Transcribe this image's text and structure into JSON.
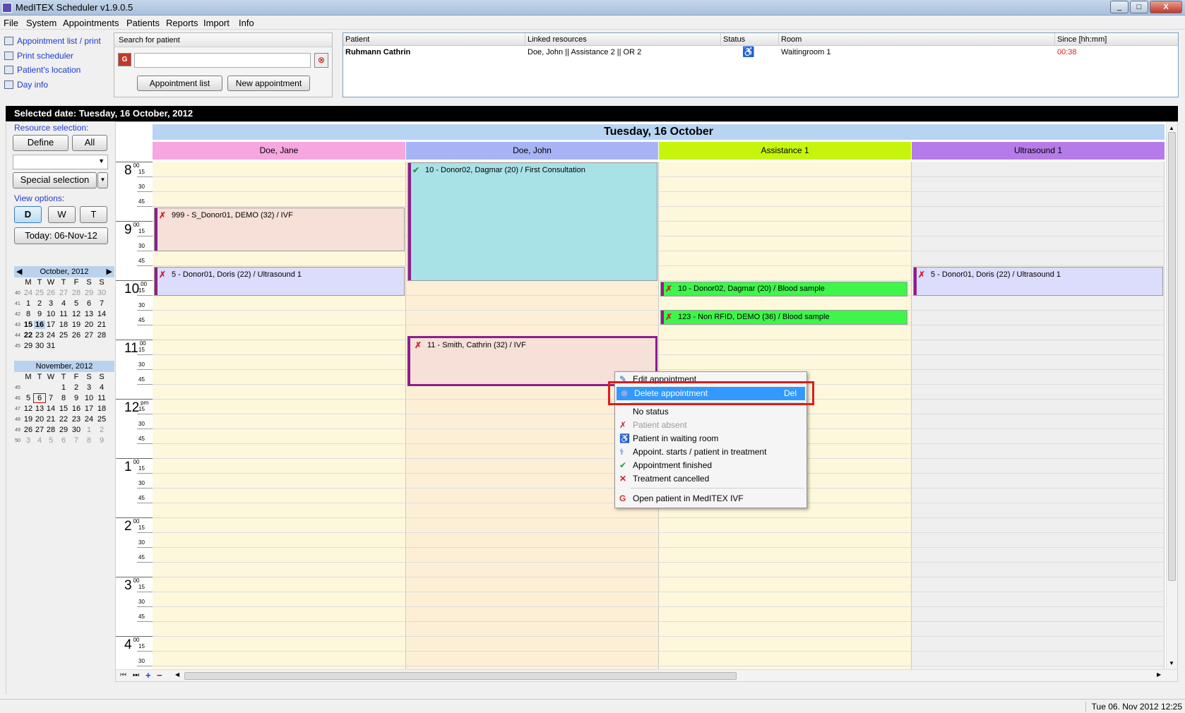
{
  "window": {
    "title": "MedITEX  Scheduler v1.9.0.5",
    "min": "_",
    "max": "□",
    "close": "X"
  },
  "menu": [
    "File",
    "System",
    "Appointments",
    "Patients",
    "Reports",
    "Import",
    "Info"
  ],
  "left_links": [
    "Appointment list / print",
    "Print scheduler",
    "Patient's location",
    "Day info"
  ],
  "search": {
    "header": "Search for patient",
    "input_value": "",
    "appointment_list": "Appointment list",
    "new_appointment": "New appointment"
  },
  "waiting": {
    "columns": [
      "Patient",
      "Linked resources",
      "Status",
      "Room",
      "Since [hh:mm]"
    ],
    "row": {
      "patient": "Ruhmann Cathrin",
      "resources": "Doe, John || Assistance 2 || OR 2",
      "room": "Waitingroom 1",
      "since": "00:38"
    }
  },
  "selected_date": "Selected date: Tuesday, 16 October, 2012",
  "options": {
    "resource_selection": "Resource selection:",
    "define": "Define",
    "all": "All",
    "special_selection": "Special selection",
    "view_options": "View options:",
    "view_buttons": [
      "D",
      "W",
      "T"
    ],
    "today": "Today: 06-Nov-12"
  },
  "calendar": {
    "oct": {
      "title": "October, 2012",
      "dow": [
        "M",
        "T",
        "W",
        "T",
        "F",
        "S",
        "S"
      ],
      "weeks": [
        {
          "wk": "40",
          "days": [
            "24",
            "25",
            "26",
            "27",
            "28",
            "29",
            "30"
          ]
        },
        {
          "wk": "41",
          "days": [
            "1",
            "2",
            "3",
            "4",
            "5",
            "6",
            "7"
          ]
        },
        {
          "wk": "42",
          "days": [
            "8",
            "9",
            "10",
            "11",
            "12",
            "13",
            "14"
          ]
        },
        {
          "wk": "43",
          "days": [
            "15",
            "16",
            "17",
            "18",
            "19",
            "20",
            "21"
          ]
        },
        {
          "wk": "44",
          "days": [
            "22",
            "23",
            "24",
            "25",
            "26",
            "27",
            "28"
          ]
        },
        {
          "wk": "45",
          "days": [
            "29",
            "30",
            "31",
            "",
            "",
            "",
            ""
          ]
        }
      ]
    },
    "nov": {
      "title": "November, 2012",
      "dow": [
        "M",
        "T",
        "W",
        "T",
        "F",
        "S",
        "S"
      ],
      "weeks": [
        {
          "wk": "45",
          "days": [
            "",
            "",
            "",
            "1",
            "2",
            "3",
            "4"
          ]
        },
        {
          "wk": "46",
          "days": [
            "5",
            "6",
            "7",
            "8",
            "9",
            "10",
            "11"
          ]
        },
        {
          "wk": "47",
          "days": [
            "12",
            "13",
            "14",
            "15",
            "16",
            "17",
            "18"
          ]
        },
        {
          "wk": "48",
          "days": [
            "19",
            "20",
            "21",
            "22",
            "23",
            "24",
            "25"
          ]
        },
        {
          "wk": "49",
          "days": [
            "26",
            "27",
            "28",
            "29",
            "30",
            "1",
            "2"
          ]
        },
        {
          "wk": "50",
          "days": [
            "3",
            "4",
            "5",
            "6",
            "7",
            "8",
            "9"
          ]
        }
      ]
    }
  },
  "schedule": {
    "day_title": "Tuesday, 16 October",
    "columns": [
      {
        "name": "Doe, Jane",
        "color": "#f7a6e0"
      },
      {
        "name": "Doe, John",
        "color": "#a6b4f5"
      },
      {
        "name": "Assistance 1",
        "color": "#c6f50c"
      },
      {
        "name": "Ultrasound 1",
        "color": "#b57ce9"
      }
    ],
    "hours": [
      {
        "h": "8",
        "s": "00"
      },
      {
        "h": "9",
        "s": "00"
      },
      {
        "h": "10",
        "s": "00"
      },
      {
        "h": "11",
        "s": "00"
      },
      {
        "h": "12",
        "s": "pm"
      },
      {
        "h": "1",
        "s": "00"
      },
      {
        "h": "2",
        "s": "00"
      },
      {
        "h": "3",
        "s": "00"
      },
      {
        "h": "4",
        "s": "00"
      }
    ],
    "minutes": [
      "15",
      "30",
      "45"
    ],
    "appointments": [
      {
        "text": "999 - S_Donor01, DEMO (32) / IVF"
      },
      {
        "text": "5 - Donor01, Doris (22) / Ultrasound 1"
      },
      {
        "text": "10 - Donor02, Dagmar (20) / First Consultation"
      },
      {
        "text": "11 - Smith, Cathrin (32) / IVF"
      },
      {
        "text": "10 - Donor02, Dagmar (20) / Blood sample"
      },
      {
        "text": "123 - Non RFID, DEMO (36) / Blood sample"
      },
      {
        "text": "5 - Donor01, Doris (22) / Ultrasound 1"
      }
    ]
  },
  "context_menu": {
    "edit": "Edit appointment",
    "delete": "Delete appointment",
    "delete_key": "Del",
    "no_status": "No status",
    "absent": "Patient absent",
    "waiting": "Patient in waiting room",
    "starts": "Appoint. starts / patient in treatment",
    "finished": "Appointment finished",
    "cancelled": "Treatment cancelled",
    "open": "Open patient in MedITEX IVF"
  },
  "status_bar": {
    "clock": "Tue 06. Nov 2012 12:25"
  }
}
